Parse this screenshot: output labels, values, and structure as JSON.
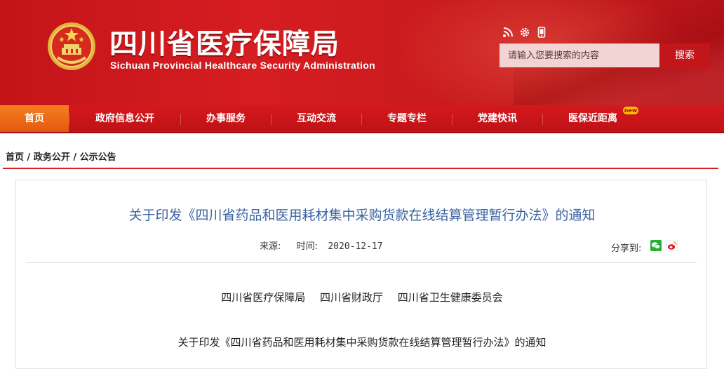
{
  "header": {
    "title": "四川省医疗保障局",
    "subtitle": "Sichuan Provincial Healthcare Security Administration",
    "icons": [
      "rss-icon",
      "settings-icon",
      "mobile-icon"
    ]
  },
  "search": {
    "placeholder": "请输入您要搜索的内容",
    "button_label": "搜索"
  },
  "nav": {
    "items": [
      {
        "label": "首页",
        "active": true
      },
      {
        "label": "政府信息公开"
      },
      {
        "label": "办事服务"
      },
      {
        "label": "互动交流"
      },
      {
        "label": "专题专栏"
      },
      {
        "label": "党建快讯"
      },
      {
        "label": "医保近距离",
        "badge": "new"
      }
    ]
  },
  "breadcrumb": {
    "items": [
      "首页",
      "政务公开",
      "公示公告"
    ],
    "separator": "/"
  },
  "article": {
    "title": "关于印发《四川省药品和医用耗材集中采购货款在线结算管理暂行办法》的通知",
    "source_label": "来源:",
    "time_label": "时间:",
    "date": "2020-12-17",
    "share_label": "分享到:",
    "share_icons": [
      "wechat-icon",
      "weibo-icon"
    ],
    "issuers": [
      "四川省医疗保障局",
      "四川省财政厅",
      "四川省卫生健康委员会"
    ],
    "body_first_line": "关于印发《四川省药品和医用耗材集中采购货款在线结算管理暂行办法》的通知"
  },
  "colors": {
    "header_red": "#c3141a",
    "nav_active": "#f57e1f",
    "title_blue": "#3b63a3",
    "accent_line": "#d71e23"
  }
}
